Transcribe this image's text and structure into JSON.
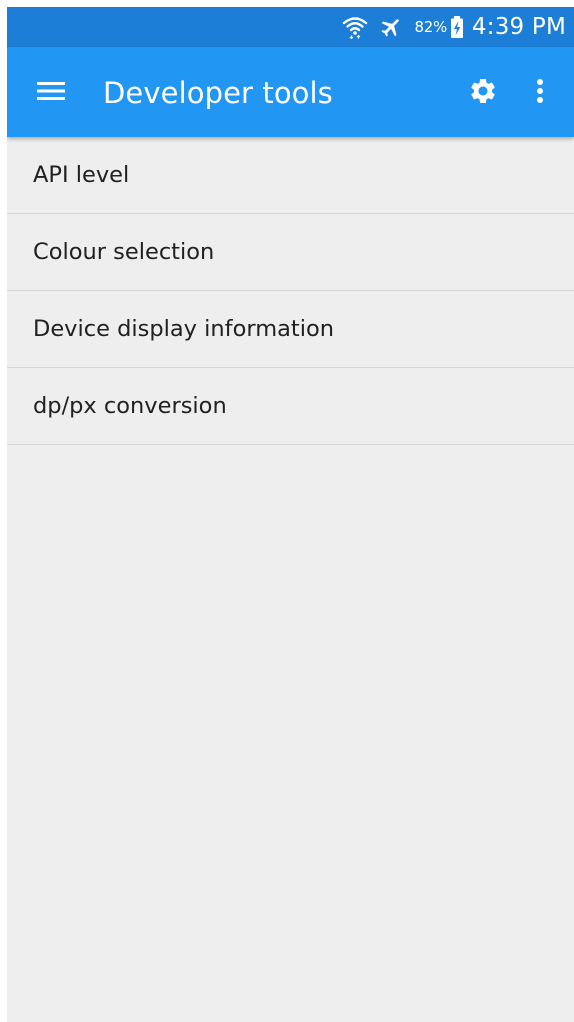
{
  "status_bar": {
    "wifi_icon": "wifi-icon",
    "airplane_icon": "airplane-icon",
    "battery_percent": "82%",
    "battery_icon": "battery-charging-icon",
    "time": "4:39 PM"
  },
  "app_bar": {
    "menu_icon": "hamburger-menu-icon",
    "title": "Developer tools",
    "settings_icon": "gear-icon",
    "overflow_icon": "more-vert-icon"
  },
  "list": {
    "items": [
      {
        "label": "API level"
      },
      {
        "label": "Colour selection"
      },
      {
        "label": "Device display information"
      },
      {
        "label": "dp/px conversion"
      }
    ]
  },
  "colors": {
    "status_bar": "#1c7ed6",
    "app_bar": "#2196f3",
    "background": "#eeeeee",
    "divider": "#d6d6d6",
    "text": "#212121"
  }
}
